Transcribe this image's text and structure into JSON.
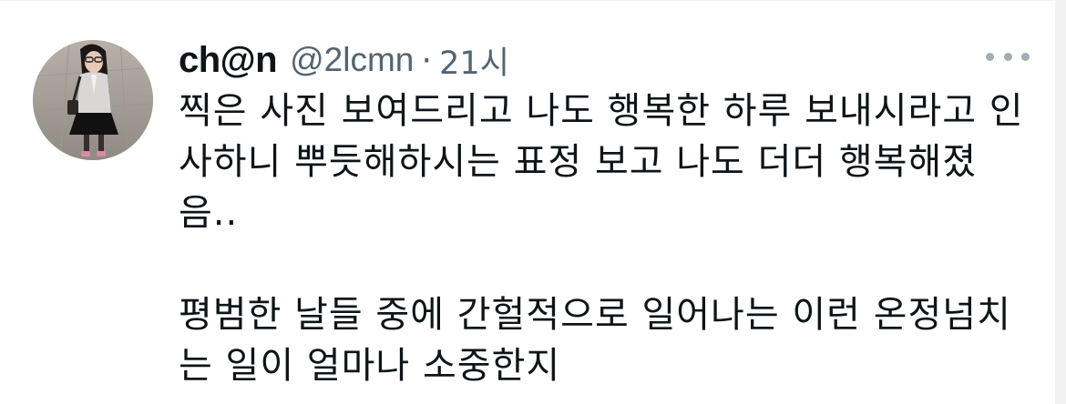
{
  "tweet": {
    "display_name": "ch@n",
    "handle": "@2lcmn",
    "separator": "·",
    "timestamp": "21시",
    "paragraphs": [
      "찍은 사진 보여드리고 나도 행복한 하루 보내시라고 인\n사하니 뿌듯해하시는 표정 보고 나도 더더 행복해졌\n음..",
      "평범한 날들 중에 간헐적으로 일어나는 이런 온정넘치\n는 일이 얼마나 소중한지"
    ]
  },
  "icons": {
    "avatar": "profile-photo",
    "more": "more-horizontal-icon"
  },
  "colors": {
    "text_primary": "#0f1419",
    "text_secondary": "#536471",
    "more_dots": "#a3adb6"
  }
}
